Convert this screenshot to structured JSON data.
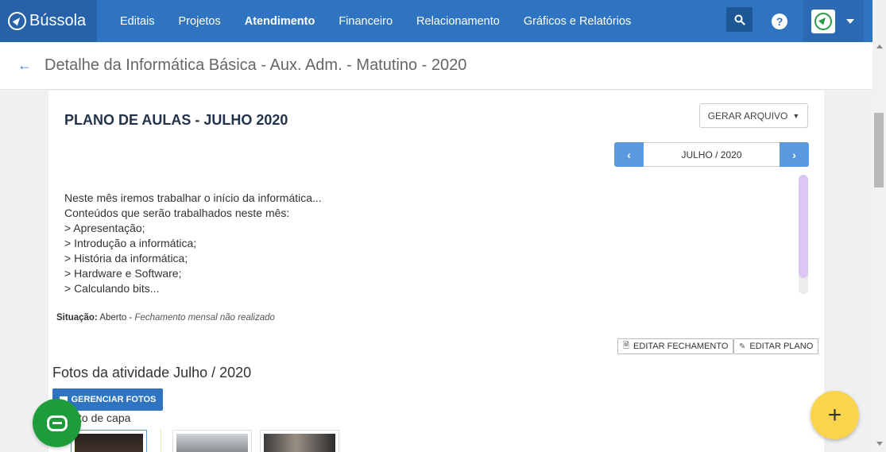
{
  "brand": {
    "name": "Bússola"
  },
  "nav": {
    "items": [
      {
        "label": "Editais",
        "active": false
      },
      {
        "label": "Projetos",
        "active": false
      },
      {
        "label": "Atendimento",
        "active": true
      },
      {
        "label": "Financeiro",
        "active": false
      },
      {
        "label": "Relacionamento",
        "active": false
      },
      {
        "label": "Gráficos e Relatórios",
        "active": false
      }
    ],
    "help_label": "?"
  },
  "header": {
    "title": "Detalhe da Informática Básica - Aux. Adm. - Matutino - 2020"
  },
  "plan": {
    "title": "PLANO DE AULAS - JULHO 2020",
    "generate_label": "GERAR ARQUIVO",
    "month_label": "JULHO / 2020",
    "prev_label": "‹",
    "next_label": "›",
    "lines": [
      "Neste mês iremos trabalhar o início da informática...",
      "Conteúdos que serão trabalhados neste mês:",
      "> Apresentação;",
      "> Introdução a informática;",
      "> História da informática;",
      "> Hardware e Software;",
      "> Calculando bits..."
    ],
    "status_label": "Situação:",
    "status_value": "Aberto",
    "status_separator": " - ",
    "status_note": "Fechamento mensal não realizado",
    "edit_closing_label": "EDITAR FECHAMENTO",
    "edit_plan_label": "EDITAR PLANO"
  },
  "photos": {
    "title": "Fotos da atividade Julho / 2020",
    "manage_label": "GERENCIAR FOTOS",
    "cover_label": "to de capa"
  },
  "colors": {
    "primary": "#2f74c0",
    "chat_green": "#1f9c3a",
    "fab_yellow": "#f9d44c"
  }
}
